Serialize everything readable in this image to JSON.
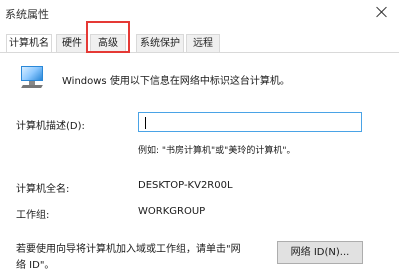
{
  "window": {
    "title": "系统属性"
  },
  "tabs": [
    {
      "label": "计算机名"
    },
    {
      "label": "硬件"
    },
    {
      "label": "高级"
    },
    {
      "label": "系统保护"
    },
    {
      "label": "远程"
    }
  ],
  "computer_name_tab": {
    "intro": "Windows 使用以下信息在网络中标识这台计算机。",
    "description_label": "计算机描述(D):",
    "description_value": "",
    "example_text": "例如: \"书房计算机\"或\"美玲的计算机\"。",
    "full_name_label": "计算机全名:",
    "full_name_value": "DESKTOP-KV2R00L",
    "workgroup_label": "工作组:",
    "workgroup_value": "WORKGROUP",
    "network_wizard_text_line1": "若要使用向导将计算机加入域或工作组，请单击\"网",
    "network_wizard_text_line2": "络 ID\"。",
    "network_id_button": "网络 ID(N)..."
  },
  "colors": {
    "highlight": "#e53935",
    "field_border": "#4aa3e6"
  },
  "icons": {
    "computer": "computer-monitor-icon",
    "close": "close-icon"
  }
}
